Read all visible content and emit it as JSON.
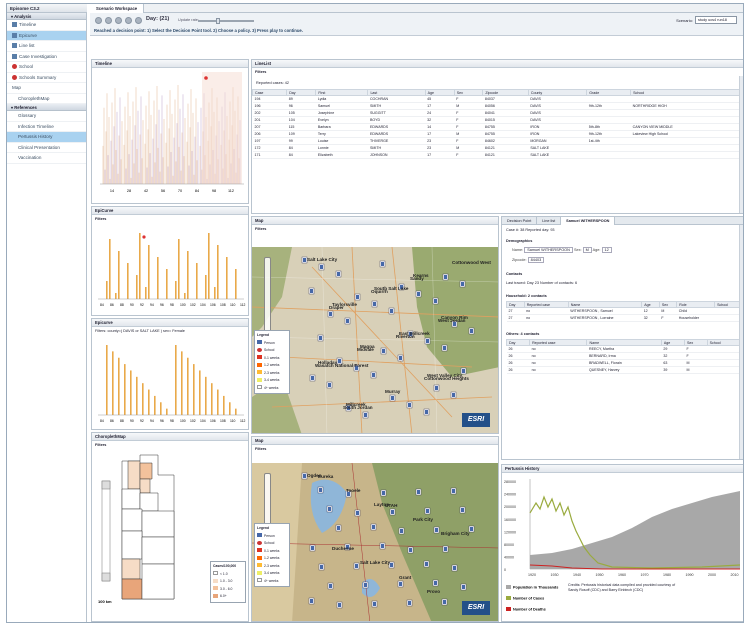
{
  "app": {
    "title": "Episome C3.2"
  },
  "tab": {
    "title": "Scenario Workspace"
  },
  "sidebar": {
    "analysis_header": "▾ Analysis",
    "analysis": [
      "Timeline",
      "Epicurve",
      "Line list",
      "Case Investigation",
      "School",
      "Schools Summary",
      "Map",
      "ChoroplethMap"
    ],
    "references_header": "▾ References",
    "references": [
      "Glossary",
      "Infection Timeline",
      "Pertussis History",
      "Clinical Presentation",
      "Vaccination"
    ]
  },
  "toolbar": {
    "day": "Day: (21)",
    "rate_label": "Update rate:",
    "message": "Reached a decision point: 1) Select the Decision Point tool. 2) Choose a policy. 3) Press play to continue.",
    "scenario_label": "Scenario:",
    "scenario_value": "study ucs4 run18"
  },
  "timeline": {
    "title": "Timeline",
    "xticks": [
      "14",
      "28",
      "42",
      "56",
      "70",
      "84",
      "98",
      "112"
    ]
  },
  "linelist": {
    "title": "LineList",
    "filters": "Filters",
    "reported": "Reported cases: 42",
    "columns": [
      "Case",
      "Day",
      "First",
      "Last",
      "Age",
      "Sex",
      "Zipcode",
      "County",
      "Grade",
      "School"
    ],
    "rows": [
      [
        "194",
        "89",
        "Lydia",
        "COCHRAN",
        "45",
        "F",
        "84037",
        "DAVIS",
        "",
        ""
      ],
      [
        "196",
        "96",
        "Samuel",
        "SMITH",
        "17",
        "M",
        "84056",
        "DAVIS",
        "9th-12th",
        "NORTHRIDGE HIGH"
      ],
      [
        "202",
        "105",
        "Josephine",
        "SUGGITT",
        "24",
        "F",
        "84041",
        "DAVIS",
        "",
        ""
      ],
      [
        "201",
        "104",
        "Evelyn",
        "BOYD",
        "32",
        "F",
        "84015",
        "DAVIS",
        "",
        ""
      ],
      [
        "207",
        "115",
        "Barbara",
        "EDWARDS",
        "14",
        "F",
        "84755",
        "IRON",
        "5th-8th",
        "CANYON VIEW MIDDLE"
      ],
      [
        "206",
        "109",
        "Terry",
        "EDWARDS",
        "17",
        "M",
        "84755",
        "IRON",
        "9th-12th",
        "Lakeview High School"
      ],
      [
        "197",
        "99",
        "Louise",
        "THIVERGE",
        "23",
        "F",
        "84602",
        "MORGAN",
        "1st-4th",
        ""
      ],
      [
        "172",
        "84",
        "Lonnie",
        "SMITH",
        "23",
        "M",
        "84121",
        "SALT LAKE",
        "",
        ""
      ],
      [
        "171",
        "84",
        "Elizabeth",
        "JOHNSON",
        "17",
        "F",
        "84121",
        "SALT LAKE",
        "",
        ""
      ]
    ]
  },
  "epicurve1": {
    "title": "EpiCurve",
    "filters": "Filters",
    "xticks": [
      "84",
      "86",
      "88",
      "90",
      "92",
      "94",
      "96",
      "98",
      "100",
      "102",
      "104",
      "106",
      "108",
      "110",
      "112"
    ]
  },
  "epicurve2": {
    "title": "Epicurve",
    "filters": "Filters: county=( DAVIS or SALT LAKE )  sex= Female",
    "xticks": [
      "84",
      "86",
      "88",
      "90",
      "92",
      "94",
      "96",
      "98",
      "100",
      "102",
      "104",
      "106",
      "108",
      "110",
      "112"
    ]
  },
  "map1": {
    "title": "Map",
    "filters": "Filters",
    "places": [
      "Salt Lake City",
      "South Salt Lake",
      "Canyon Rim",
      "Magna",
      "West Valley City",
      "Millcreek",
      "Kearns",
      "Taylorsville",
      "East Millcreek",
      "Holladay",
      "Murray",
      "Cottonwood West",
      "Oquirrh",
      "West Jordan",
      "Midvale",
      "Cottonwood Heights",
      "South Jordan",
      "Sandy",
      "Draper",
      "Riverton",
      "Wasatch National Forest"
    ],
    "legend": [
      "Person",
      "School",
      "0-1 weeks",
      "1-2 weeks",
      "2-3 weeks",
      "3-4 weeks",
      "4+ weeks"
    ]
  },
  "map2": {
    "title": "Map",
    "filters": "Filters",
    "places": [
      "Ogden",
      "Layton",
      "Brigham City",
      "Salt Lake City",
      "Provo",
      "Tooele",
      "Park City",
      "Duchesne",
      "Grant",
      "Eureka",
      "UTAH"
    ],
    "legend": [
      "Person",
      "School",
      "0-1 weeks",
      "1-2 weeks",
      "2-3 weeks",
      "3-4 weeks",
      "4+ weeks"
    ]
  },
  "choropleth": {
    "title": "ChoroplethMap",
    "filters": "Filters",
    "legend_title": "Cases/100,000",
    "legend": [
      "< 1.0",
      "1.0 - 3.0",
      "3.0 - 6.0",
      "6.0+"
    ],
    "scale": "100 km"
  },
  "detail": {
    "tabs": [
      "Decision Point",
      "Line list",
      "Samuel WITHERSPOON"
    ],
    "case_line": "Case #: 38  Reported day: 93",
    "demographics": "Demographics",
    "name_label": "Name:",
    "name": "Samuel WITHERSPOON",
    "sex_label": "Sex:",
    "sex": "M",
    "age_label": "Age:",
    "age": "12",
    "zip_label": "Zipcode:",
    "zip": "84403",
    "contacts": "Contacts",
    "last_traced": "Last traced:  Day 23  Number of contacts: 6",
    "household": "Household: 2 contacts",
    "hh_columns": [
      "Day",
      "Reported case",
      "Name",
      "Age",
      "Sex",
      "Role",
      "School"
    ],
    "hh_rows": [
      [
        "27",
        "no",
        "WITHERSPOON , Samuel",
        "12",
        "M",
        "Child",
        ""
      ],
      [
        "27",
        "no",
        "WITHERSPOON , Lorraine",
        "32",
        "F",
        "Householder",
        ""
      ]
    ],
    "others": "Others: 4 contacts",
    "ot_columns": [
      "Day",
      "Reported case",
      "Name",
      "Age",
      "Sex",
      "School"
    ],
    "ot_rows": [
      [
        "26",
        "no",
        "REECY, Martha",
        "29",
        "F",
        ""
      ],
      [
        "26",
        "no",
        "BERNARD, Irma",
        "32",
        "F",
        ""
      ],
      [
        "26",
        "no",
        "BRADWELL, Florain",
        "63",
        "M",
        ""
      ],
      [
        "26",
        "no",
        "QUESNEY, Harvey",
        "39",
        "M",
        ""
      ]
    ]
  },
  "history": {
    "title": "Pertussis History",
    "ylabel_ticks": [
      "280000",
      "240000",
      "200000",
      "160000",
      "120000",
      "80000",
      "40000",
      "0"
    ],
    "xticks": [
      "1920",
      "1930",
      "1940",
      "1950",
      "1960",
      "1970",
      "1980",
      "1990",
      "2000",
      "2010"
    ],
    "legend": [
      "Population in Thousands",
      "Number of Cases",
      "Number of Deaths"
    ],
    "credits": "Credits: Pertussis historical data compiled and provided courtesy of Sandy Rosoff (CDC) and Barry Einbinch (CDC)"
  },
  "colors": {
    "accent": "#a9d2f0",
    "bar": "#e9a94a",
    "grey": "#a8a8a8",
    "olive": "#9aab3f",
    "red": "#cc2222"
  }
}
